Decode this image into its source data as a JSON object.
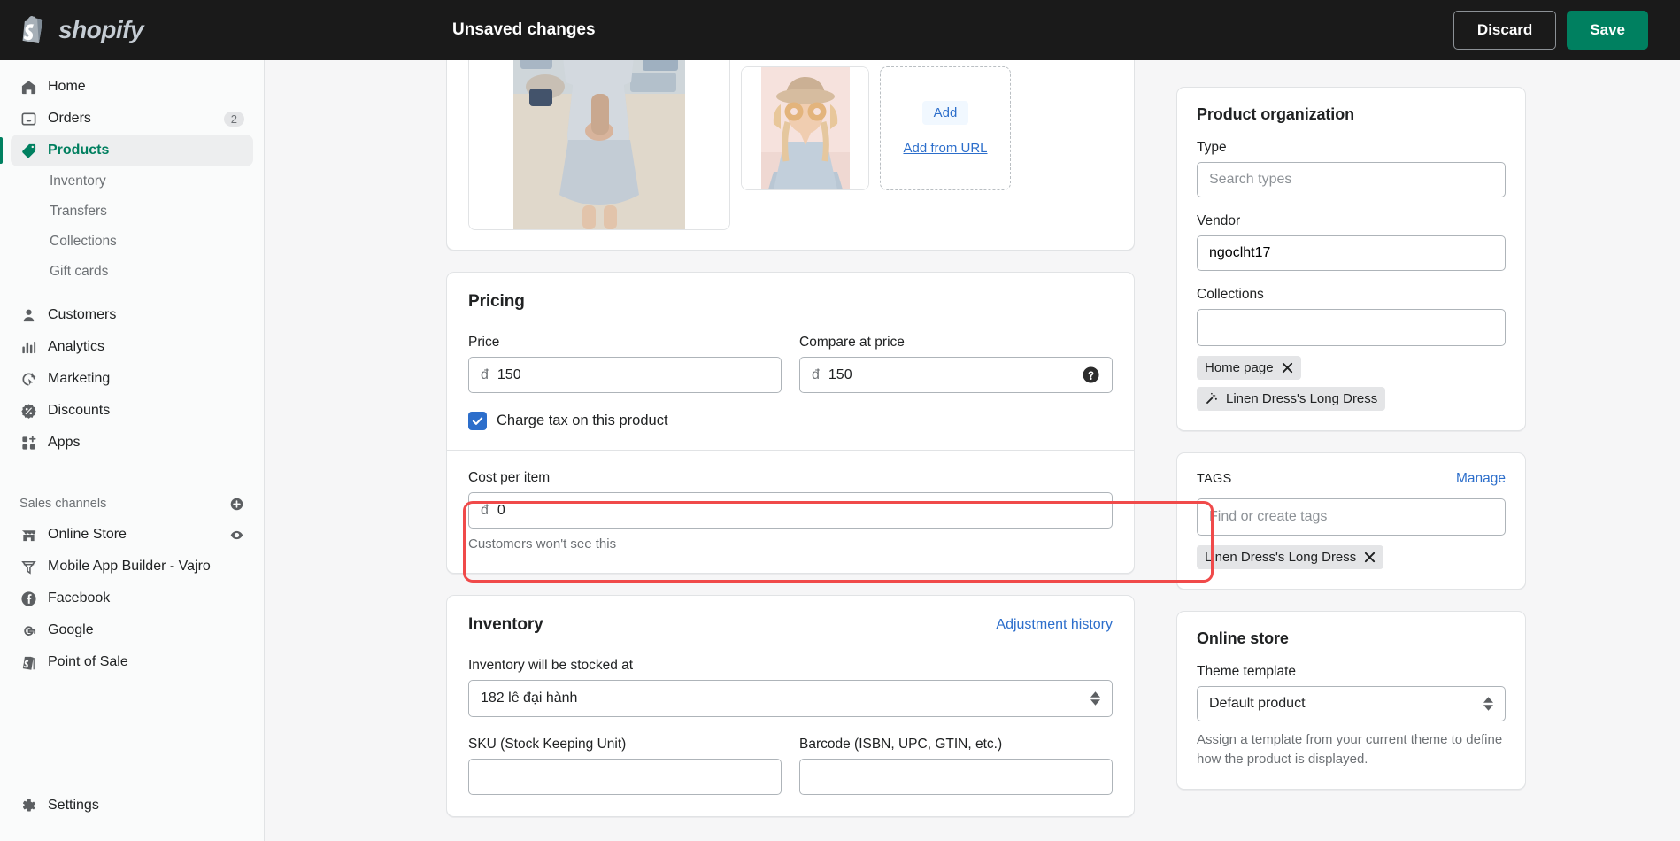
{
  "topbar": {
    "brand": "shopify",
    "status": "Unsaved changes",
    "discard_label": "Discard",
    "save_label": "Save",
    "brand_color": "#c6cdd4",
    "save_color": "#008060"
  },
  "sidebar": {
    "items": [
      {
        "label": "Home",
        "icon": "home-icon",
        "badge": "",
        "active": false
      },
      {
        "label": "Orders",
        "icon": "orders-icon",
        "badge": "2",
        "active": false
      },
      {
        "label": "Products",
        "icon": "products-tag-icon",
        "badge": "",
        "active": true
      }
    ],
    "sub_items": [
      {
        "label": "Inventory"
      },
      {
        "label": "Transfers"
      },
      {
        "label": "Collections"
      },
      {
        "label": "Gift cards"
      }
    ],
    "items2": [
      {
        "label": "Customers",
        "icon": "customer-icon"
      },
      {
        "label": "Analytics",
        "icon": "analytics-icon"
      },
      {
        "label": "Marketing",
        "icon": "marketing-icon"
      },
      {
        "label": "Discounts",
        "icon": "discount-icon"
      },
      {
        "label": "Apps",
        "icon": "apps-icon"
      }
    ],
    "sales_channels_label": "Sales channels",
    "channels": [
      {
        "label": "Online Store",
        "icon": "store-icon",
        "trailing": "eye-icon"
      },
      {
        "label": "Mobile App Builder - Vajro",
        "icon": "vajro-icon",
        "trailing": ""
      },
      {
        "label": "Facebook",
        "icon": "facebook-icon",
        "trailing": ""
      },
      {
        "label": "Google",
        "icon": "google-icon",
        "trailing": ""
      },
      {
        "label": "Point of Sale",
        "icon": "pos-icon",
        "trailing": ""
      }
    ],
    "settings_label": "Settings",
    "active_color": "#007f5f"
  },
  "media": {
    "add_label": "Add",
    "add_url_label": "Add from URL"
  },
  "pricing": {
    "title": "Pricing",
    "price_label": "Price",
    "price_currency": "đ",
    "price_value": "150",
    "compare_label": "Compare at price",
    "compare_currency": "đ",
    "compare_value": "150",
    "help_icon": "help-circle-icon",
    "charge_tax_label": "Charge tax on this product",
    "charge_tax_checked": true,
    "cost_label": "Cost per item",
    "cost_currency": "đ",
    "cost_value": "0",
    "cost_helper": "Customers won't see this",
    "highlight_color": "#f04a4a"
  },
  "inventory": {
    "title": "Inventory",
    "adjustment_link": "Adjustment history",
    "stocked_label": "Inventory will be stocked at",
    "stocked_value": "182 lê đại hành",
    "sku_label": "SKU (Stock Keeping Unit)",
    "barcode_label": "Barcode (ISBN, UPC, GTIN, etc.)"
  },
  "product_organization": {
    "title": "Product organization",
    "type_label": "Type",
    "type_placeholder": "Search types",
    "vendor_label": "Vendor",
    "vendor_value": "ngoclht17",
    "collections_label": "Collections",
    "collections_value": "",
    "collection_chips": [
      {
        "label": "Home page",
        "icon": ""
      },
      {
        "label": "Linen Dress's Long Dress",
        "icon": "magic-wand-icon"
      }
    ]
  },
  "tags": {
    "label": "TAGS",
    "manage_label": "Manage",
    "placeholder": "Find or create tags",
    "chips": [
      {
        "label": "Linen Dress's Long Dress"
      }
    ]
  },
  "online_store": {
    "title": "Online store",
    "theme_label": "Theme template",
    "theme_value": "Default product",
    "description": "Assign a template from your current theme to define how the product is displayed."
  }
}
